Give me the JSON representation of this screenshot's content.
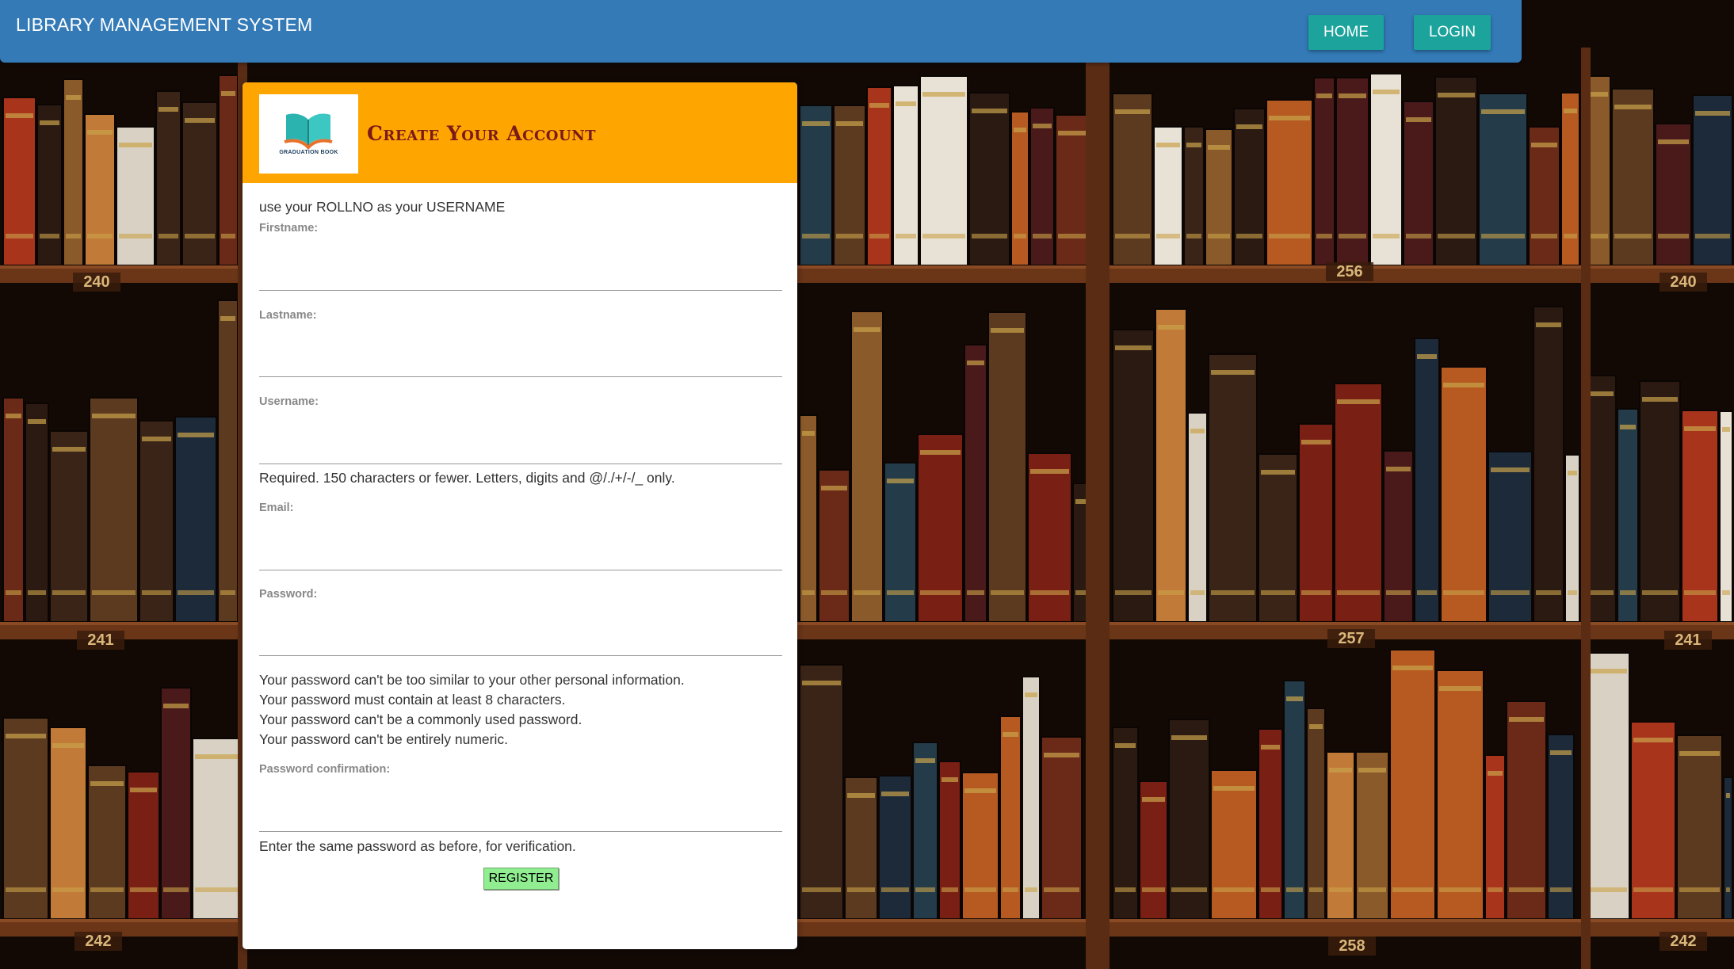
{
  "navbar": {
    "brand": "LIBRARY MANAGEMENT SYSTEM",
    "home_label": "HOME",
    "login_label": "LOGIN",
    "color": "#337ab7",
    "button_color": "#1ba39c"
  },
  "card": {
    "logo_text": "GRADUATION BOOK",
    "title": "Create Your Account",
    "header_color": "#ffa500",
    "intro": "use your ROLLNO as your USERNAME",
    "fields": {
      "firstname": {
        "label": "Firstname:",
        "value": ""
      },
      "lastname": {
        "label": "Lastname:",
        "value": ""
      },
      "username": {
        "label": "Username:",
        "value": "",
        "help": "Required. 150 characters or fewer. Letters, digits and @/./+/-/_ only."
      },
      "email": {
        "label": "Email:",
        "value": ""
      },
      "password": {
        "label": "Password:",
        "value": "",
        "help": [
          "Your password can't be too similar to your other personal information.",
          "Your password must contain at least 8 characters.",
          "Your password can't be a commonly used password.",
          "Your password can't be entirely numeric."
        ]
      },
      "password_confirmation": {
        "label": "Password confirmation:",
        "value": "",
        "help": "Enter the same password as before, for verification."
      }
    },
    "register_label": "REGISTER",
    "register_color": "#90ee90"
  },
  "background": {
    "shelf_labels": [
      "240",
      "256",
      "240",
      "241",
      "257",
      "241",
      "242",
      "258",
      "242"
    ]
  }
}
